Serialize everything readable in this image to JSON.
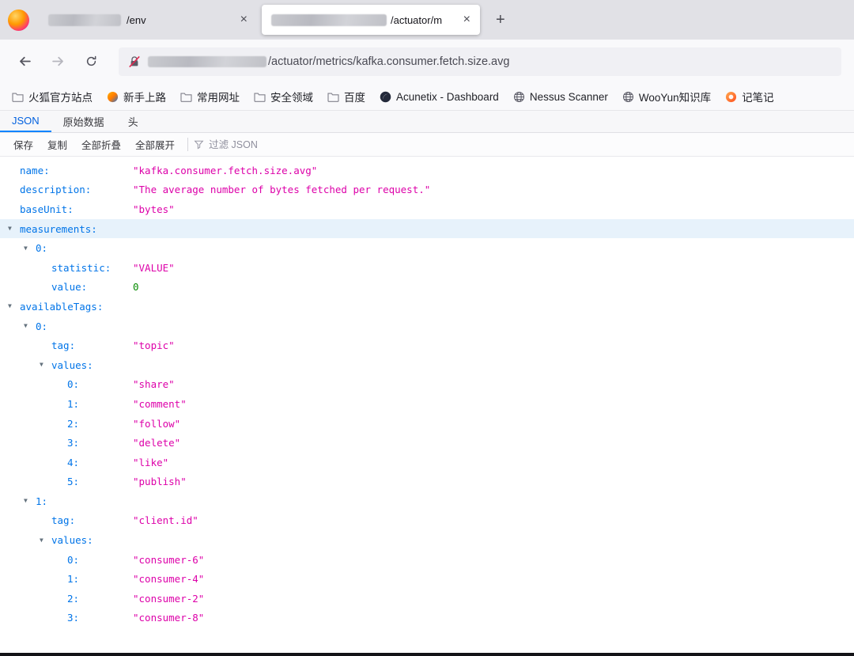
{
  "window": {
    "tab_bar": {
      "tabs": [
        {
          "redacted_title": true,
          "title_suffix": "/env",
          "active": false
        },
        {
          "redacted_title": true,
          "title_suffix": "/actuator/m",
          "active": true
        }
      ],
      "new_tab_label": "+"
    },
    "nav": {
      "url_redacted_domain": true,
      "url_path": "/actuator/metrics/kafka.consumer.fetch.size.avg"
    },
    "bookmarks": [
      {
        "label": "火狐官方站点",
        "icon": "folder-icon"
      },
      {
        "label": "新手上路",
        "icon": "sphere-icon"
      },
      {
        "label": "常用网址",
        "icon": "folder-icon"
      },
      {
        "label": "安全领域",
        "icon": "folder-icon"
      },
      {
        "label": "百度",
        "icon": "folder-icon"
      },
      {
        "label": "Acunetix - Dashboard",
        "icon": "acunetix-icon"
      },
      {
        "label": "Nessus Scanner",
        "icon": "globe-icon"
      },
      {
        "label": "WooYun知识库",
        "icon": "globe-icon"
      },
      {
        "label": "记笔记",
        "icon": "notes-icon"
      }
    ]
  },
  "json_viewer": {
    "tabs": [
      {
        "label": "JSON",
        "active": true
      },
      {
        "label": "原始数据",
        "active": false
      },
      {
        "label": "头",
        "active": false
      }
    ],
    "toolbar": {
      "save": "保存",
      "copy": "复制",
      "collapse_all": "全部折叠",
      "expand_all": "全部展开",
      "filter_placeholder": "过滤 JSON"
    },
    "highlighted_key": "measurements",
    "colors": {
      "key": "#0074e8",
      "string": "#dd00a9",
      "number": "#058b00",
      "accent": "#0060df"
    }
  },
  "json_document": {
    "name": "kafka.consumer.fetch.size.avg",
    "description": "The average number of bytes fetched per request.",
    "baseUnit": "bytes",
    "measurements": [
      {
        "statistic": "VALUE",
        "value": 0
      }
    ],
    "availableTags": [
      {
        "tag": "topic",
        "values": [
          "share",
          "comment",
          "follow",
          "delete",
          "like",
          "publish"
        ]
      },
      {
        "tag": "client.id",
        "values": [
          "consumer-6",
          "consumer-4",
          "consumer-2",
          "consumer-8"
        ]
      }
    ]
  }
}
